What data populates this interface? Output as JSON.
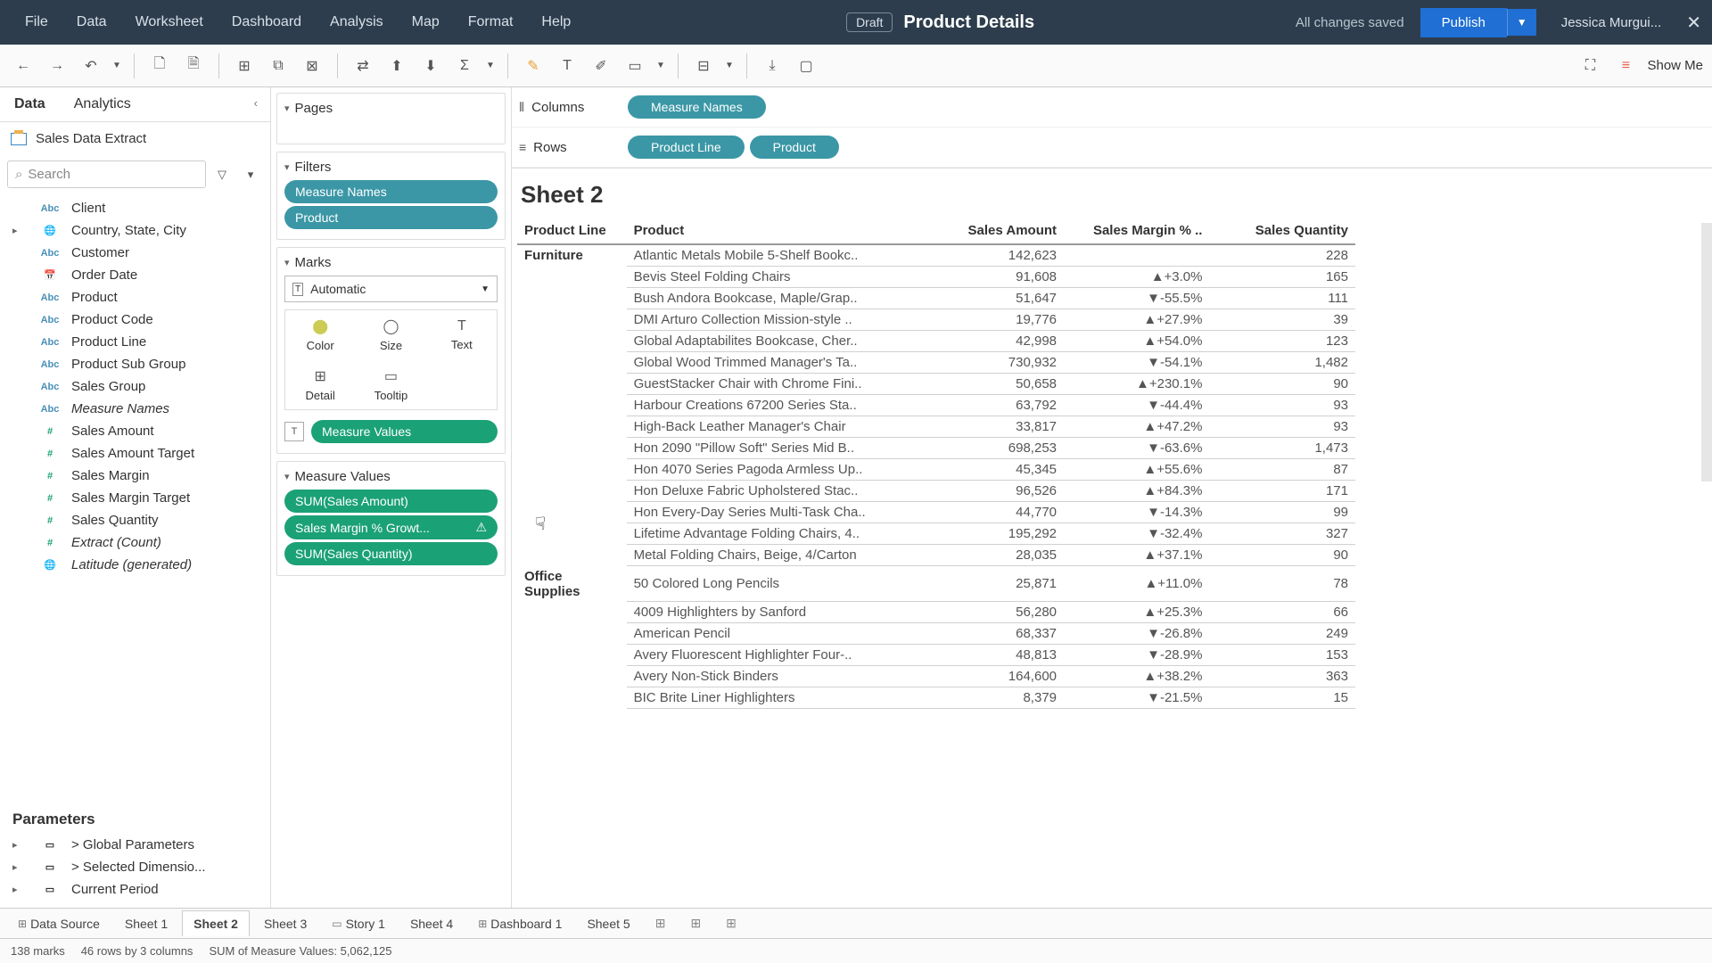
{
  "header": {
    "menu": [
      "File",
      "Data",
      "Worksheet",
      "Dashboard",
      "Analysis",
      "Map",
      "Format",
      "Help"
    ],
    "draft_label": "Draft",
    "title": "Product Details",
    "save_status": "All changes saved",
    "publish_label": "Publish",
    "user": "Jessica Murgui..."
  },
  "showme_label": "Show Me",
  "data_tabs": {
    "data": "Data",
    "analytics": "Analytics"
  },
  "datasource": "Sales Data Extract",
  "search_placeholder": "Search",
  "fields": [
    {
      "t": "abc",
      "n": "Client"
    },
    {
      "t": "globe",
      "n": "Country, State, City",
      "exp": true
    },
    {
      "t": "abc",
      "n": "Customer"
    },
    {
      "t": "date",
      "n": "Order Date"
    },
    {
      "t": "abc",
      "n": "Product"
    },
    {
      "t": "abc",
      "n": "Product Code"
    },
    {
      "t": "abc",
      "n": "Product Line"
    },
    {
      "t": "abc",
      "n": "Product Sub Group"
    },
    {
      "t": "abc",
      "n": "Sales Group"
    },
    {
      "t": "abc",
      "n": "Measure Names",
      "it": true
    },
    {
      "t": "num",
      "n": "Sales Amount"
    },
    {
      "t": "num",
      "n": "Sales Amount Target"
    },
    {
      "t": "num",
      "n": "Sales Margin"
    },
    {
      "t": "num",
      "n": "Sales Margin Target"
    },
    {
      "t": "num",
      "n": "Sales Quantity"
    },
    {
      "t": "num",
      "n": "Extract (Count)",
      "it": true
    },
    {
      "t": "globe",
      "n": "Latitude (generated)",
      "it": true
    }
  ],
  "parameters_label": "Parameters",
  "params": [
    {
      "n": "> Global Parameters",
      "exp": true
    },
    {
      "n": "> Selected Dimensio...",
      "exp": true
    },
    {
      "n": "Current Period",
      "exp": true
    }
  ],
  "cards": {
    "pages": "Pages",
    "filters": "Filters",
    "filter_pills": [
      "Measure Names",
      "Product"
    ],
    "marks": "Marks",
    "mark_type": "Automatic",
    "mark_cells": [
      "Color",
      "Size",
      "Text",
      "Detail",
      "Tooltip"
    ],
    "text_pill": "Measure Values",
    "measure_values": "Measure Values",
    "mv_pills": [
      "SUM(Sales Amount)",
      "Sales Margin % Growt...",
      "SUM(Sales Quantity)"
    ]
  },
  "shelves": {
    "columns_label": "Columns",
    "columns_pills": [
      "Measure Names"
    ],
    "rows_label": "Rows",
    "rows_pills": [
      "Product Line",
      "Product"
    ]
  },
  "sheet_title": "Sheet 2",
  "table": {
    "headers": [
      "Product Line",
      "Product",
      "Sales Amount",
      "Sales Margin % ..",
      "Sales Quantity"
    ],
    "rows": [
      {
        "pl": "Furniture",
        "p": "Atlantic Metals Mobile 5-Shelf Bookc..",
        "a": "142,623",
        "m": "",
        "q": "228"
      },
      {
        "p": "Bevis Steel Folding Chairs",
        "a": "91,608",
        "m": "▲+3.0%",
        "q": "165"
      },
      {
        "p": "Bush Andora Bookcase, Maple/Grap..",
        "a": "51,647",
        "m": "▼-55.5%",
        "q": "111"
      },
      {
        "p": "DMI Arturo Collection Mission-style ..",
        "a": "19,776",
        "m": "▲+27.9%",
        "q": "39"
      },
      {
        "p": "Global Adaptabilites Bookcase, Cher..",
        "a": "42,998",
        "m": "▲+54.0%",
        "q": "123"
      },
      {
        "p": "Global Wood Trimmed Manager's Ta..",
        "a": "730,932",
        "m": "▼-54.1%",
        "q": "1,482"
      },
      {
        "p": "GuestStacker Chair with Chrome Fini..",
        "a": "50,658",
        "m": "▲+230.1%",
        "q": "90"
      },
      {
        "p": "Harbour Creations 67200 Series Sta..",
        "a": "63,792",
        "m": "▼-44.4%",
        "q": "93"
      },
      {
        "p": "High-Back Leather Manager's Chair",
        "a": "33,817",
        "m": "▲+47.2%",
        "q": "93"
      },
      {
        "p": "Hon 2090 \"Pillow Soft\" Series Mid B..",
        "a": "698,253",
        "m": "▼-63.6%",
        "q": "1,473"
      },
      {
        "p": "Hon 4070 Series Pagoda Armless Up..",
        "a": "45,345",
        "m": "▲+55.6%",
        "q": "87"
      },
      {
        "p": "Hon Deluxe Fabric Upholstered Stac..",
        "a": "96,526",
        "m": "▲+84.3%",
        "q": "171"
      },
      {
        "p": "Hon Every-Day Series Multi-Task Cha..",
        "a": "44,770",
        "m": "▼-14.3%",
        "q": "99"
      },
      {
        "p": "Lifetime Advantage Folding Chairs, 4..",
        "a": "195,292",
        "m": "▼-32.4%",
        "q": "327"
      },
      {
        "p": "Metal Folding Chairs, Beige, 4/Carton",
        "a": "28,035",
        "m": "▲+37.1%",
        "q": "90"
      },
      {
        "pl": "Office Supplies",
        "p": "50 Colored Long Pencils",
        "a": "25,871",
        "m": "▲+11.0%",
        "q": "78"
      },
      {
        "p": "4009 Highlighters by Sanford",
        "a": "56,280",
        "m": "▲+25.3%",
        "q": "66"
      },
      {
        "p": "American Pencil",
        "a": "68,337",
        "m": "▼-26.8%",
        "q": "249"
      },
      {
        "p": "Avery Fluorescent Highlighter Four-..",
        "a": "48,813",
        "m": "▼-28.9%",
        "q": "153"
      },
      {
        "p": "Avery Non-Stick Binders",
        "a": "164,600",
        "m": "▲+38.2%",
        "q": "363"
      },
      {
        "p": "BIC Brite Liner Highlighters",
        "a": "8,379",
        "m": "▼-21.5%",
        "q": "15"
      }
    ]
  },
  "bottom_tabs": [
    "Data Source",
    "Sheet 1",
    "Sheet 2",
    "Sheet 3",
    "Story 1",
    "Sheet 4",
    "Dashboard 1",
    "Sheet 5"
  ],
  "status": {
    "marks": "138 marks",
    "dims": "46 rows by 3 columns",
    "sum": "SUM of Measure Values: 5,062,125"
  }
}
